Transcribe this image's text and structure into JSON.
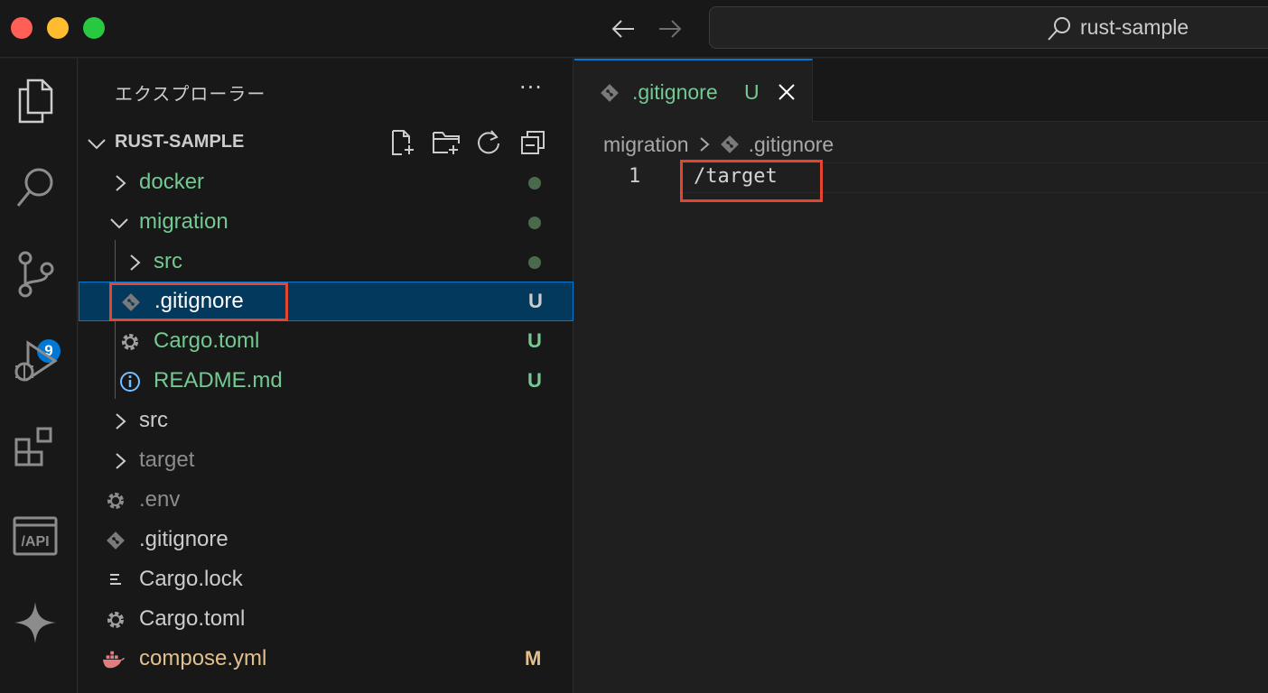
{
  "titlebar": {
    "search_text": "rust-sample"
  },
  "activity": {
    "items": [
      "explorer-icon",
      "search-icon",
      "source-control-icon",
      "run-debug-icon",
      "extensions-icon",
      "api-icon",
      "sparkle-icon"
    ],
    "scm_badge": "9",
    "api_label": "/API"
  },
  "explorer": {
    "title": "エクスプローラー",
    "more": "···",
    "section_label": "RUST-SAMPLE",
    "rows": [
      {
        "label": "docker",
        "status": ""
      },
      {
        "label": "migration",
        "status": ""
      },
      {
        "label": "src",
        "status": ""
      },
      {
        "label": ".gitignore",
        "status": "U"
      },
      {
        "label": "Cargo.toml",
        "status": "U"
      },
      {
        "label": "README.md",
        "status": "U"
      },
      {
        "label": "src",
        "status": ""
      },
      {
        "label": "target",
        "status": ""
      },
      {
        "label": ".env",
        "status": ""
      },
      {
        "label": ".gitignore",
        "status": ""
      },
      {
        "label": "Cargo.lock",
        "status": ""
      },
      {
        "label": "Cargo.toml",
        "status": ""
      },
      {
        "label": "compose.yml",
        "status": "M"
      }
    ]
  },
  "editor": {
    "tab_label": ".gitignore",
    "tab_status": "U",
    "breadcrumb": [
      "migration",
      ".gitignore"
    ],
    "line_number": "1",
    "code_line": "/target"
  },
  "colors": {
    "accent": "#0078d4",
    "untracked_green": "#73c991",
    "modified_yellow": "#e2c08d",
    "highlight_red": "#e5452e",
    "selection_bg": "#04395e"
  }
}
